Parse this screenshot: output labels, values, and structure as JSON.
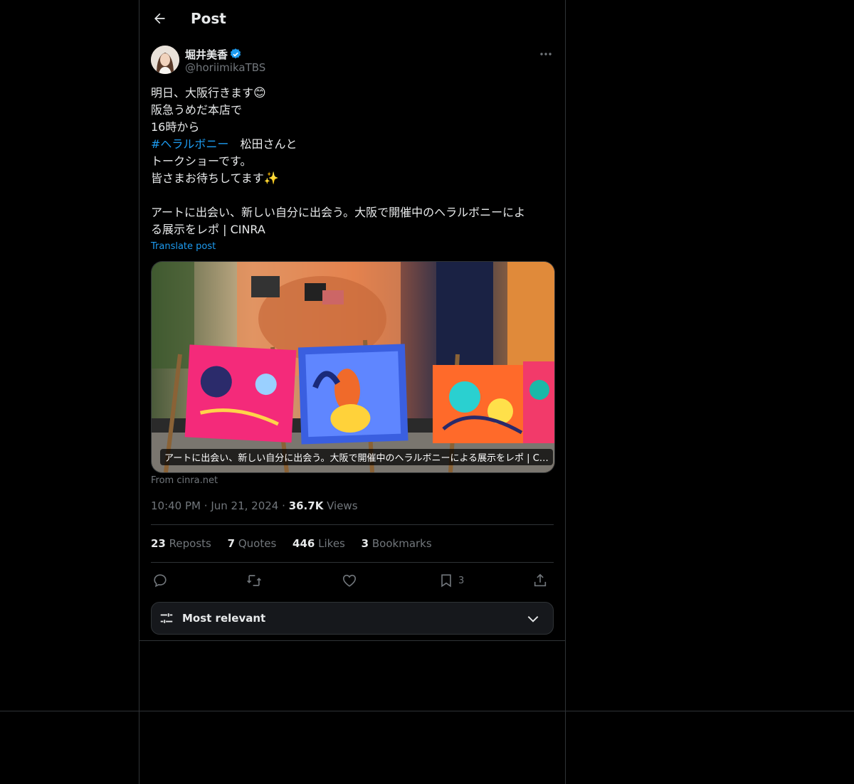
{
  "header": {
    "title": "Post"
  },
  "author": {
    "name": "堀井美香",
    "handle": "@horiimikaTBS"
  },
  "tweet": {
    "lines": [
      "明日、大阪行きます",
      "阪急うめだ本店で",
      "16時から",
      "松田さんと",
      "トークショーです。",
      "皆さまお待ちしてます"
    ],
    "emoji_smile": "😊",
    "emoji_sparkles": "✨",
    "hashtag": "#ヘラルボニー",
    "link_title_line1": "アートに出会い、新しい自分に出会う。大阪で開催中のヘラルボニーによ",
    "link_title_line2": "る展示をレポ | CINRA",
    "translate": "Translate post"
  },
  "card": {
    "caption": "アートに出会い、新しい自分に出会う。大阪で開催中のヘラルボニーによる展示をレポ | CINRA",
    "from": "From cinra.net"
  },
  "meta": {
    "time": "10:40 PM",
    "date": "Jun 21, 2024",
    "views_count": "36.7K",
    "views_label": "Views",
    "dot": "·"
  },
  "stats": {
    "reposts_count": "23",
    "reposts_label": "Reposts",
    "quotes_count": "7",
    "quotes_label": "Quotes",
    "likes_count": "446",
    "likes_label": "Likes",
    "bookmarks_count": "3",
    "bookmarks_label": "Bookmarks"
  },
  "actions": {
    "bookmark_count": "3"
  },
  "sort": {
    "label": "Most relevant"
  },
  "colors": {
    "accent": "#1d9bf0",
    "background": "#000000",
    "border": "#2f3336",
    "muted": "#71767b"
  }
}
